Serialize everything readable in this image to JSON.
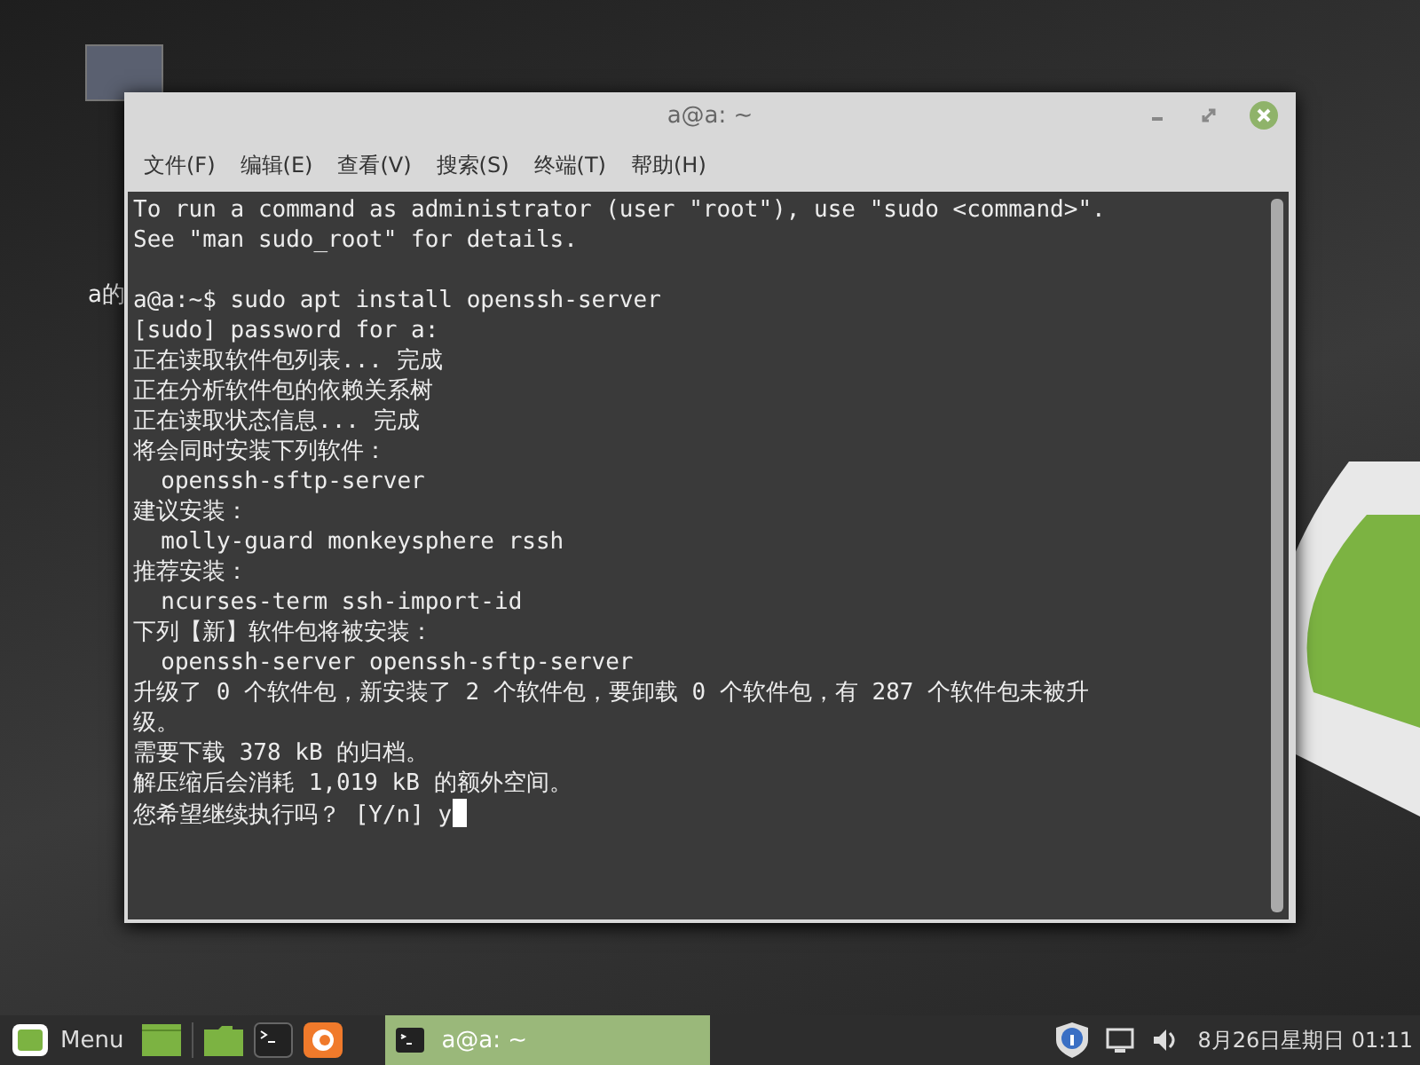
{
  "desktop": {
    "icons": [
      {
        "label": "a的"
      }
    ]
  },
  "window": {
    "title": "a@a: ~"
  },
  "menu": [
    {
      "label": "文件(F)"
    },
    {
      "label": "编辑(E)"
    },
    {
      "label": "查看(V)"
    },
    {
      "label": "搜索(S)"
    },
    {
      "label": "终端(T)"
    },
    {
      "label": "帮助(H)"
    }
  ],
  "terminal": {
    "blocks": [
      [
        "To run a command as administrator (user \"root\"), use \"sudo <command>\".",
        "See \"man sudo_root\" for details."
      ],
      [
        "a@a:~$ sudo apt install openssh-server",
        "[sudo] password for a:",
        "正在读取软件包列表... 完成",
        "正在分析软件包的依赖关系树",
        "正在读取状态信息... 完成",
        "将会同时安装下列软件：",
        "  openssh-sftp-server",
        "建议安装：",
        "  molly-guard monkeysphere rssh",
        "推荐安装：",
        "  ncurses-term ssh-import-id",
        "下列【新】软件包将被安装：",
        "  openssh-server openssh-sftp-server",
        "升级了 0 个软件包，新安装了 2 个软件包，要卸载 0 个软件包，有 287 个软件包未被升",
        "级。",
        "需要下载 378 kB 的归档。",
        "解压缩后会消耗 1,019 kB 的额外空间。",
        "您希望继续执行吗？ [Y/n] y"
      ]
    ],
    "cursor": true
  },
  "taskbar": {
    "menu_label": "Menu",
    "tasks": [
      {
        "label": "a@a: ~",
        "selected": true
      }
    ],
    "clock": "8月26日星期日 01:11"
  }
}
